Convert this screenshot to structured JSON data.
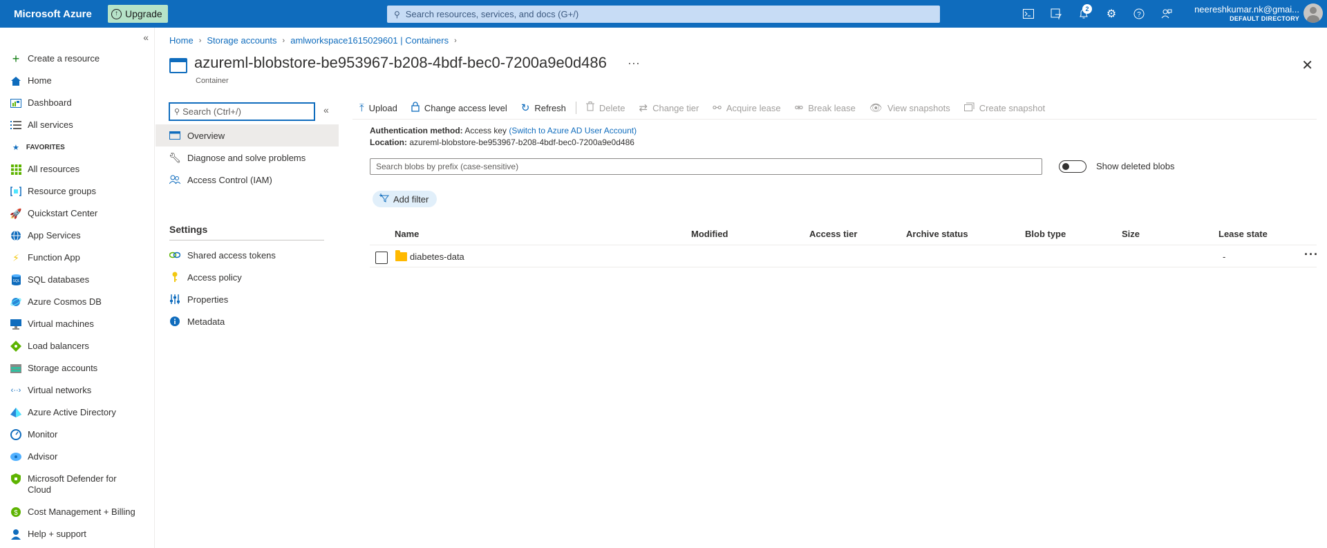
{
  "topbar": {
    "brand": "Microsoft Azure",
    "upgrade_label": "Upgrade",
    "search_placeholder": "Search resources, services, and docs (G+/)",
    "notifications_count": "2",
    "user_name": "neereshkumar.nk@gmai...",
    "user_directory": "DEFAULT DIRECTORY",
    "accent_color": "#0f6cbd"
  },
  "leftnav": {
    "favorites_label": "FAVORITES",
    "items": [
      {
        "label": "Create a resource",
        "icon": "plus-icon"
      },
      {
        "label": "Home",
        "icon": "home-icon"
      },
      {
        "label": "Dashboard",
        "icon": "dashboard-icon"
      },
      {
        "label": "All services",
        "icon": "list-icon"
      },
      {
        "label": "All resources",
        "icon": "grid-icon"
      },
      {
        "label": "Resource groups",
        "icon": "resource-group-icon"
      },
      {
        "label": "Quickstart Center",
        "icon": "rocket-icon"
      },
      {
        "label": "App Services",
        "icon": "globe-icon"
      },
      {
        "label": "Function App",
        "icon": "bolt-icon"
      },
      {
        "label": "SQL databases",
        "icon": "sql-icon"
      },
      {
        "label": "Azure Cosmos DB",
        "icon": "cosmos-icon"
      },
      {
        "label": "Virtual machines",
        "icon": "vm-icon"
      },
      {
        "label": "Load balancers",
        "icon": "load-balancer-icon"
      },
      {
        "label": "Storage accounts",
        "icon": "storage-icon"
      },
      {
        "label": "Virtual networks",
        "icon": "network-icon"
      },
      {
        "label": "Azure Active Directory",
        "icon": "aad-icon"
      },
      {
        "label": "Monitor",
        "icon": "monitor-icon"
      },
      {
        "label": "Advisor",
        "icon": "advisor-icon"
      },
      {
        "label": "Microsoft Defender for Cloud",
        "icon": "shield-icon"
      },
      {
        "label": "Cost Management + Billing",
        "icon": "cost-icon"
      },
      {
        "label": "Help + support",
        "icon": "help-icon"
      }
    ]
  },
  "breadcrumb": [
    "Home",
    "Storage accounts",
    "amlworkspace1615029601 | Containers"
  ],
  "header": {
    "title": "azureml-blobstore-be953967-b208-4bdf-bec0-7200a9e0d486",
    "subtitle": "Container",
    "more": "···"
  },
  "resource_menu": {
    "search_placeholder": "Search (Ctrl+/)",
    "items": [
      "Overview",
      "Diagnose and solve problems",
      "Access Control (IAM)"
    ],
    "settings_label": "Settings",
    "settings_items": [
      "Shared access tokens",
      "Access policy",
      "Properties",
      "Metadata"
    ]
  },
  "toolbar": {
    "upload": "Upload",
    "change_access": "Change access level",
    "refresh": "Refresh",
    "delete": "Delete",
    "change_tier": "Change tier",
    "acquire_lease": "Acquire lease",
    "break_lease": "Break lease",
    "view_snapshots": "View snapshots",
    "create_snapshot": "Create snapshot"
  },
  "info": {
    "auth_label": "Authentication method:",
    "auth_value": "Access key",
    "auth_link": "(Switch to Azure AD User Account)",
    "location_label": "Location:",
    "location_value": "azureml-blobstore-be953967-b208-4bdf-bec0-7200a9e0d486"
  },
  "blob_search_placeholder": "Search blobs by prefix (case-sensitive)",
  "show_deleted_label": "Show deleted blobs",
  "add_filter_label": "Add filter",
  "table": {
    "columns": [
      "Name",
      "Modified",
      "Access tier",
      "Archive status",
      "Blob type",
      "Size",
      "Lease state"
    ],
    "rows": [
      {
        "name": "diabetes-data",
        "modified": "",
        "access_tier": "",
        "archive_status": "",
        "blob_type": "",
        "size": "",
        "lease_state": "-"
      }
    ]
  }
}
